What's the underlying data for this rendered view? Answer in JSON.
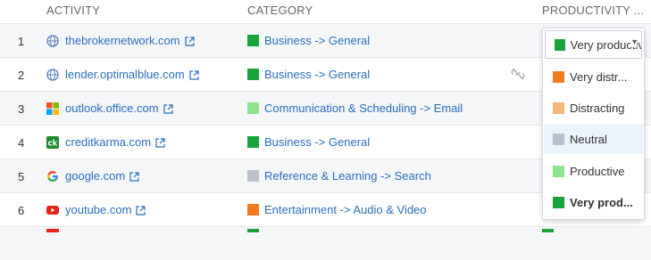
{
  "header": {
    "activity": "ACTIVITY",
    "category": "CATEGORY",
    "productivity": "PRODUCTIVITY ..."
  },
  "colors": {
    "very_productive": "#1aa33b",
    "productive": "#8de38e",
    "neutral": "#b8c1cb",
    "distracting": "#f8b77a",
    "very_distracting": "#f47a20",
    "link": "#2a6ebb"
  },
  "rows": [
    {
      "num": "1",
      "site": "thebrokernetwork.com",
      "icon": "globe-icon",
      "category": "Business -> General",
      "cat_color": "#1aa33b"
    },
    {
      "num": "2",
      "site": "lender.optimalblue.com",
      "icon": "globe-icon",
      "category": "Business -> General",
      "cat_color": "#1aa33b"
    },
    {
      "num": "3",
      "site": "outlook.office.com",
      "icon": "office-logo-icon",
      "category": "Communication & Scheduling -> Email",
      "cat_color": "#8de38e"
    },
    {
      "num": "4",
      "site": "creditkarma.com",
      "icon": "creditkarma-logo-icon",
      "category": "Business -> General",
      "cat_color": "#1aa33b"
    },
    {
      "num": "5",
      "site": "google.com",
      "icon": "google-logo-icon",
      "category": "Reference & Learning -> Search",
      "cat_color": "#b8c1cb"
    },
    {
      "num": "6",
      "site": "youtube.com",
      "icon": "youtube-logo-icon",
      "category": "Entertainment -> Audio & Video",
      "cat_color": "#f47a20"
    }
  ],
  "dropdown": {
    "selected": "Very productive",
    "options": [
      {
        "label": "Very distr...",
        "color": "#f47a20"
      },
      {
        "label": "Distracting",
        "color": "#f8b77a"
      },
      {
        "label": "Neutral",
        "color": "#b8c1cb"
      },
      {
        "label": "Productive",
        "color": "#8de38e"
      },
      {
        "label": "Very prod...",
        "color": "#1aa33b"
      }
    ]
  }
}
